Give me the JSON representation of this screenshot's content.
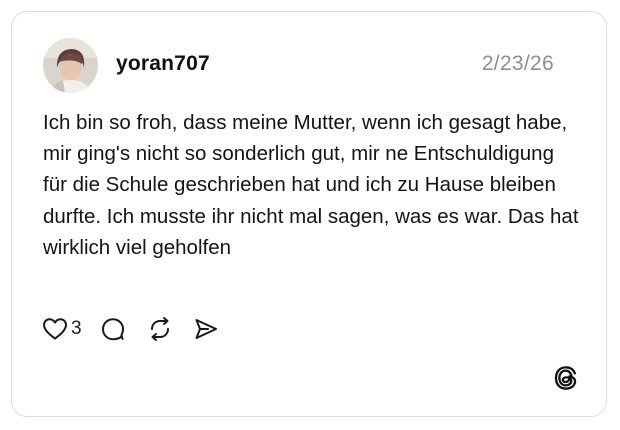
{
  "post": {
    "username": "yoran707",
    "date": "2/23/26",
    "text": "Ich bin so froh, dass meine Mutter, wenn ich gesagt habe, mir ging's nicht so sonderlich gut, mir ne Entschuldigung für die Schule geschrieben hat und ich zu Hause bleiben durfte. Ich musste ihr nicht mal sagen, was es war. Das hat wirklich viel geholfen",
    "like_count": "3"
  },
  "icons": {
    "like": "heart-icon",
    "reply": "comment-icon",
    "repost": "repost-icon",
    "share": "send-icon",
    "brand": "threads-logo-icon"
  },
  "colors": {
    "text": "#141414",
    "muted": "#8e8e8e",
    "border": "#dcdcdc"
  }
}
